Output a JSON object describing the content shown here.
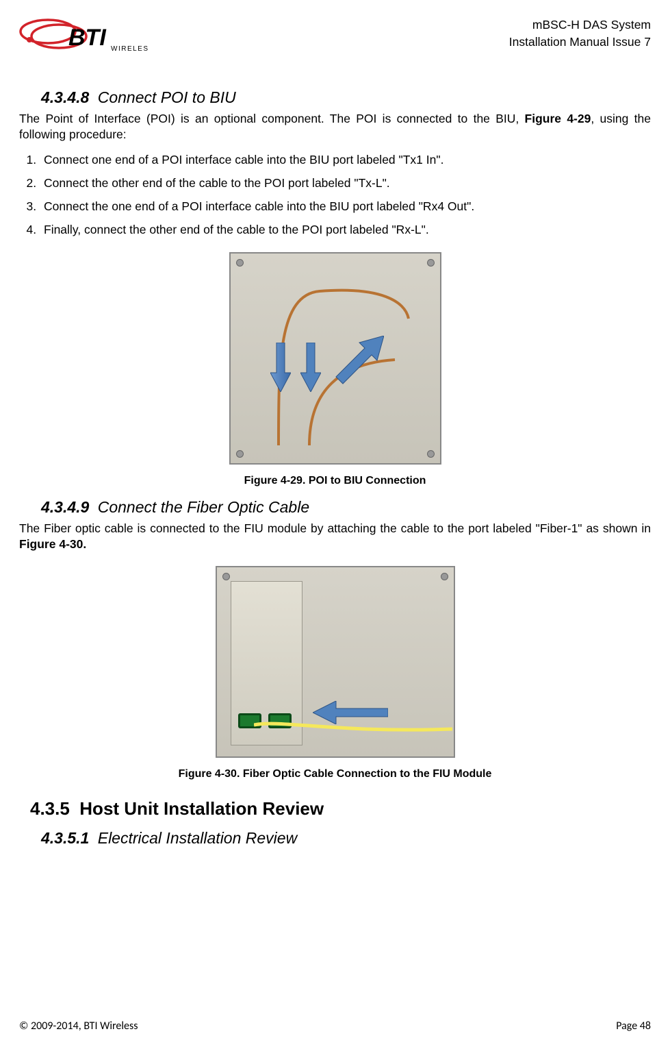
{
  "header": {
    "logo_text_main": "BTI",
    "logo_text_sub": "WIRELESS",
    "right_line1": "mBSC-H DAS System",
    "right_line2": "Installation Manual Issue 7"
  },
  "section1": {
    "number": "4.3.4.8",
    "title": "Connect POI to BIU",
    "body_prefix": "The Point of Interface (POI) is an optional component. The POI is connected to the BIU, ",
    "body_bold": "Figure 4-29",
    "body_suffix": ", using the following procedure:",
    "steps": [
      "Connect one end of a POI interface cable into the BIU port labeled \"Tx1 In\".",
      "Connect the other end of the cable to the POI port labeled \"Tx-L\".",
      "Connect the one end of a POI interface cable into the BIU port labeled \"Rx4 Out\".",
      "Finally, connect the other end of the cable to the POI port labeled \"Rx-L\"."
    ],
    "figure_caption": "Figure 4-29. POI to BIU Connection"
  },
  "section2": {
    "number": "4.3.4.9",
    "title": "Connect the Fiber Optic Cable",
    "body_prefix": "The Fiber optic cable is connected to the FIU module by attaching the cable to the port labeled \"Fiber-1\" as shown in ",
    "body_bold": "Figure 4-30.",
    "figure_caption": "Figure 4-30. Fiber Optic Cable Connection to the FIU Module"
  },
  "section3": {
    "number": "4.3.5",
    "title": "Host Unit Installation Review"
  },
  "section4": {
    "number": "4.3.5.1",
    "title": "Electrical Installation Review"
  },
  "footer": {
    "left": "© 2009-2014, BTI Wireless",
    "right": "Page 48"
  },
  "colors": {
    "logo_red": "#d2232a",
    "arrow_blue": "#4f81bd",
    "fiber_yellow": "#f5e85b"
  }
}
